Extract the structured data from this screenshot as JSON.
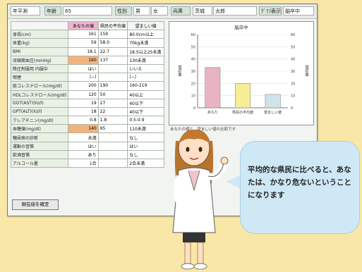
{
  "toolbar": {
    "app_label": "年平測",
    "age_label": "年齢",
    "age_value": "65",
    "sex_label": "性別",
    "sex_male": "男",
    "sex_female": "女",
    "pref_label": "兵庫",
    "district_label": "茨城",
    "name_value": "太郎",
    "graph_label": "ｸﾞﾗﾌ表示",
    "graph_select": "脳卒中"
  },
  "table": {
    "headers": [
      "",
      "あなたの値",
      "県民の平均値",
      "望ましい値"
    ],
    "rows": [
      {
        "label": "身長(cm)",
        "value": "161",
        "mean": "159",
        "target": "80.0cm以上",
        "hl": false
      },
      {
        "label": "体重(kg)",
        "value": "59",
        "mean": "58.0",
        "target": "70kg未満",
        "hl": false
      },
      {
        "label": "BMI",
        "value": "18.1",
        "mean": "22.7",
        "target": "18.5以上25未満",
        "hl": false
      },
      {
        "label": "収縮期血圧(mmHg)",
        "value": "160",
        "mean": "137",
        "target": "130未満",
        "hl": true
      },
      {
        "label": "降圧剤服用 内服中",
        "value": "はい",
        "mean": "",
        "target": "いいえ",
        "hl": false
      },
      {
        "label": "喫煙",
        "value": "(−)",
        "mean": "",
        "target": "(−)",
        "hl": false
      },
      {
        "label": "総コレステロール(mg/dl)",
        "value": "200",
        "mean": "190",
        "target": "160-219",
        "hl": false
      },
      {
        "label": "HDLコレステロール(mg/dl)",
        "value": "120",
        "mean": "50",
        "target": "40以上",
        "hl": false
      },
      {
        "label": "GOT(AST)(IU/l)",
        "value": "19",
        "mean": "27",
        "target": "40以下",
        "hl": false
      },
      {
        "label": "GPT(ALT)(IU/l)",
        "value": "18",
        "mean": "22",
        "target": "40以下",
        "hl": false
      },
      {
        "label": "クレアチニン(mg/dl)",
        "value": "0.8",
        "mean": "1.8",
        "target": "0.5-0.9",
        "hl": false
      },
      {
        "label": "血糖値(mg/dl)",
        "value": "140",
        "mean": "95",
        "target": "110未満",
        "hl": true
      },
      {
        "label": "糖尿病の診断",
        "value": "未満",
        "mean": "",
        "target": "なし",
        "hl": false
      },
      {
        "label": "運動の習慣",
        "value": "はい",
        "mean": "",
        "target": "はい",
        "hl": false
      },
      {
        "label": "飲酒習慣",
        "value": "あり",
        "mean": "",
        "target": "なし",
        "hl": false
      },
      {
        "label": "アルコール量",
        "value": "1合",
        "mean": "",
        "target": "2合未満",
        "hl": false
      }
    ]
  },
  "confirm_label": "現在値を確定",
  "chart_data": {
    "type": "bar",
    "title": "脳卒中",
    "categories": [
      "あなた",
      "県民の平均値",
      "望ましい値"
    ],
    "values": [
      33,
      20,
      11
    ],
    "colors": [
      "#e8b4c2",
      "#f6ee96",
      "#cfe3ea"
    ],
    "ylim": [
      0,
      60
    ],
    "yticks": [
      0,
      10,
      20,
      30,
      40,
      50,
      60
    ],
    "ylabel_left": "発症率",
    "ylabel_right": "発症率"
  },
  "footnote": "あなたの値と、望ましい値の比較です",
  "bubble_text": "平均的な県民に比べると、あなたは、かなり危ないということになります"
}
